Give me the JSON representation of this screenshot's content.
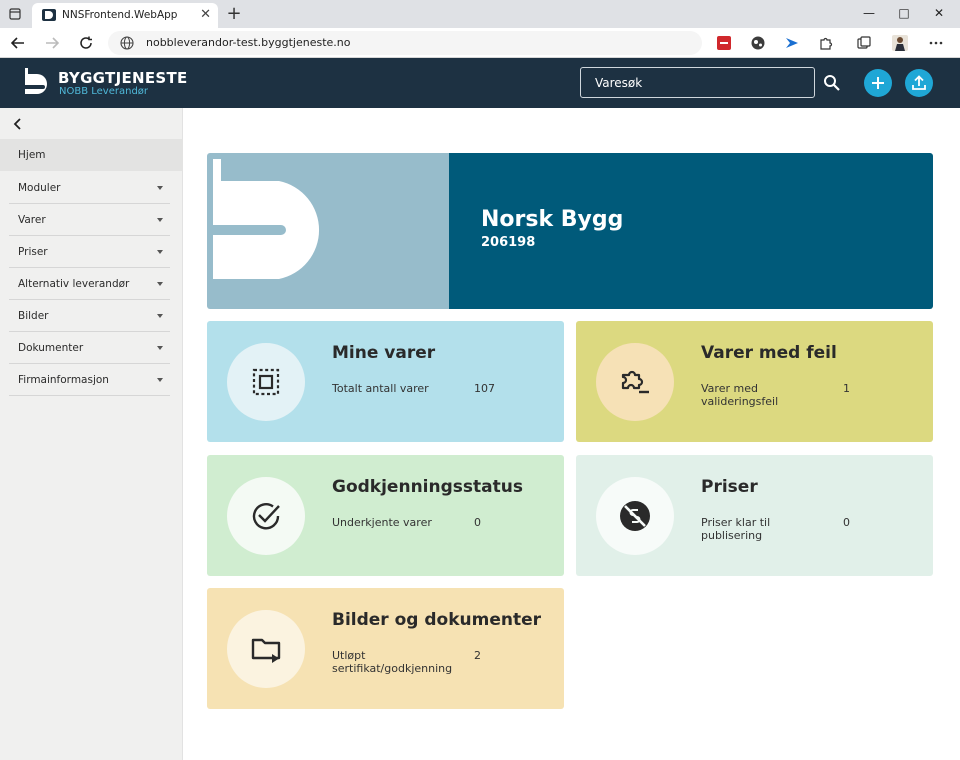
{
  "browser": {
    "tab_title": "NNSFrontend.WebApp",
    "tab_close": "✕",
    "new_tab": "+",
    "url": "nobbleverandor-test.byggtjeneste.no",
    "window_controls": [
      "—",
      "□",
      "✕"
    ]
  },
  "header": {
    "brand": "BYGGTJENESTE",
    "brand_sub": "NOBB Leverandør",
    "search_placeholder": "Varesøk",
    "icons": [
      "search-icon",
      "plus-icon",
      "upload-icon"
    ],
    "accent_color": "#1fa7d6",
    "bg_color": "#1d3142"
  },
  "sidebar": {
    "collapse_icon": "chevron-left-icon",
    "items": [
      {
        "label": "Hjem",
        "active": true
      },
      {
        "label": "Moduler"
      },
      {
        "label": "Varer"
      },
      {
        "label": "Priser"
      },
      {
        "label": "Alternativ leverandør"
      },
      {
        "label": "Bilder"
      },
      {
        "label": "Dokumenter"
      },
      {
        "label": "Firmainformasjon"
      }
    ]
  },
  "hero": {
    "company_name": "Norsk Bygg",
    "company_id": "206198"
  },
  "cards": [
    {
      "title": "Mine varer",
      "label": "Totalt antall varer",
      "value": "107",
      "color": "#b3e0eb",
      "icon": "select-all-icon"
    },
    {
      "title": "Varer med feil",
      "label": "Varer med valideringsfeil",
      "value": "1",
      "color": "#dcd980",
      "icon": "extension-off-icon"
    },
    {
      "title": "Godkjenningsstatus",
      "label": "Underkjente varer",
      "value": "0",
      "color": "#d0edd0",
      "icon": "check-circle-icon"
    },
    {
      "title": "Priser",
      "label": "Priser klar til publisering",
      "value": "0",
      "color": "#e1f0e9",
      "icon": "money-off-icon"
    },
    {
      "title": "Bilder og dokumenter",
      "label": "Utløpt sertifikat/godkjenning",
      "value": "2",
      "color": "#f6e2b3",
      "icon": "folder-play-icon"
    }
  ]
}
